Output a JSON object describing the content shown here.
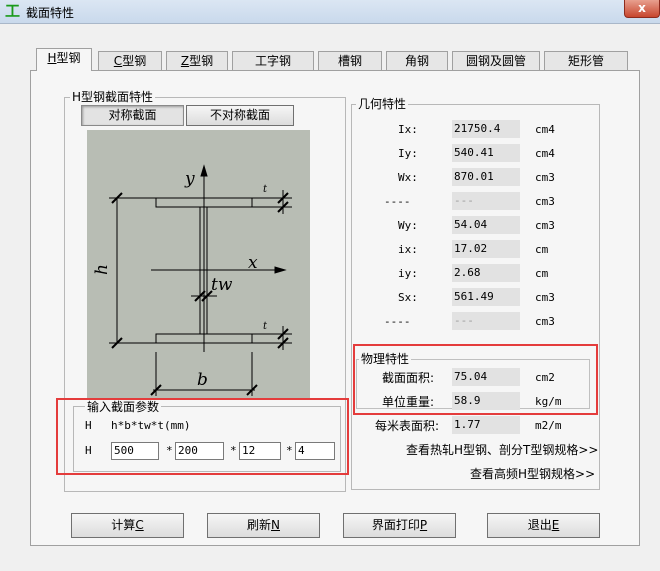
{
  "window": {
    "title": "截面特性",
    "icon_text": "工",
    "close_label": "x"
  },
  "tabs": [
    {
      "label": "H型钢",
      "mnemonic": "H",
      "rest": "型钢",
      "active": true
    },
    {
      "label": "C型钢",
      "mnemonic": "C",
      "rest": "型钢"
    },
    {
      "label": "Z型钢",
      "mnemonic": "Z",
      "rest": "型钢"
    },
    {
      "label": "工字钢"
    },
    {
      "label": "槽钢"
    },
    {
      "label": "角钢"
    },
    {
      "label": "圆钢及圆管"
    },
    {
      "label": "矩形管"
    }
  ],
  "section_group": {
    "title": "H型钢截面特性",
    "symmetric_button": "对称截面",
    "asymmetric_button": "不对称截面"
  },
  "diagram_labels": {
    "y": "y",
    "x": "x",
    "h": "h",
    "b": "b",
    "tw": "tw",
    "t_top": "t",
    "t_bottom": "t"
  },
  "input_group": {
    "title": "输入截面参数",
    "row1_label": "H",
    "formula": "h*b*tw*t(mm)",
    "row2_label": "H",
    "h": "500",
    "b": "200",
    "tw": "12",
    "t": "4",
    "sep": "*"
  },
  "geometry": {
    "title": "几何特性",
    "rows": [
      {
        "label": "Ix:",
        "value": "21750.4",
        "unit": "cm4"
      },
      {
        "label": "Iy:",
        "value": "540.41",
        "unit": "cm4"
      },
      {
        "label": "Wx:",
        "value": "870.01",
        "unit": "cm3"
      },
      {
        "label": "----",
        "value": "---",
        "unit": "cm3"
      },
      {
        "label": "Wy:",
        "value": "54.04",
        "unit": "cm3"
      },
      {
        "label": "ix:",
        "value": "17.02",
        "unit": "cm"
      },
      {
        "label": "iy:",
        "value": "2.68",
        "unit": "cm"
      },
      {
        "label": "Sx:",
        "value": "561.49",
        "unit": "cm3"
      },
      {
        "label": "----",
        "value": "---",
        "unit": "cm3"
      }
    ]
  },
  "physical": {
    "title": "物理特性",
    "area_label": "截面面积:",
    "area_value": "75.04",
    "area_unit": "cm2",
    "weight_label": "单位重量:",
    "weight_value": "58.9",
    "weight_unit": "kg/m",
    "surface_label": "每米表面积:",
    "surface_value": "1.77",
    "surface_unit": "m2/m"
  },
  "links": {
    "hot_rolled": "查看热轧H型钢、剖分T型钢规格>>",
    "high_freq": "查看高频H型钢规格>>"
  },
  "buttons": {
    "calc": "计算",
    "calc_key": "C",
    "refresh": "刷新",
    "refresh_key": "N",
    "print": "界面打印",
    "print_key": "P",
    "exit": "退出",
    "exit_key": "E"
  },
  "colors": {
    "highlight": "#e43c3c",
    "diagram_bg": "#b8bdb4",
    "icon": "#1a9a1a"
  }
}
